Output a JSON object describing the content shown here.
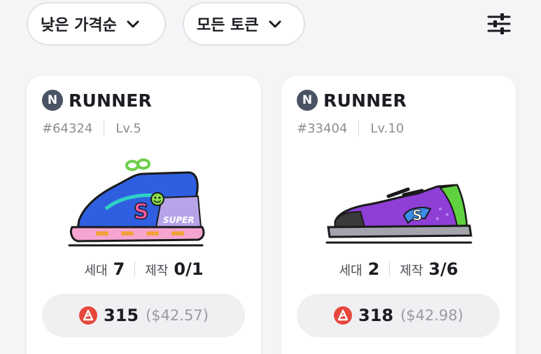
{
  "filters": {
    "sort_label": "낮은 가격순",
    "token_label": "모든 토큰"
  },
  "icons": {
    "sort_chevron": "chevron-down-icon",
    "token_chevron": "chevron-down-icon",
    "settings": "sliders-icon",
    "brand": "n-logo-icon",
    "token": "token-icon"
  },
  "colors": {
    "brand_logo": "#4a5264",
    "token_red": "#e8473b",
    "price_usd": "#9a9aa2"
  },
  "cards": [
    {
      "brand_letter": "N",
      "brand_name": "RUNNER",
      "id": "#64324",
      "level": "Lv.5",
      "generation_label": "세대",
      "generation_value": "7",
      "craft_label": "제작",
      "craft_value": "0/1",
      "price": "315",
      "price_usd": "($42.57)",
      "shoe_label": "SUPER"
    },
    {
      "brand_letter": "N",
      "brand_name": "RUNNER",
      "id": "#33404",
      "level": "Lv.10",
      "generation_label": "세대",
      "generation_value": "2",
      "craft_label": "제작",
      "craft_value": "3/6",
      "price": "318",
      "price_usd": "($42.98)"
    }
  ]
}
